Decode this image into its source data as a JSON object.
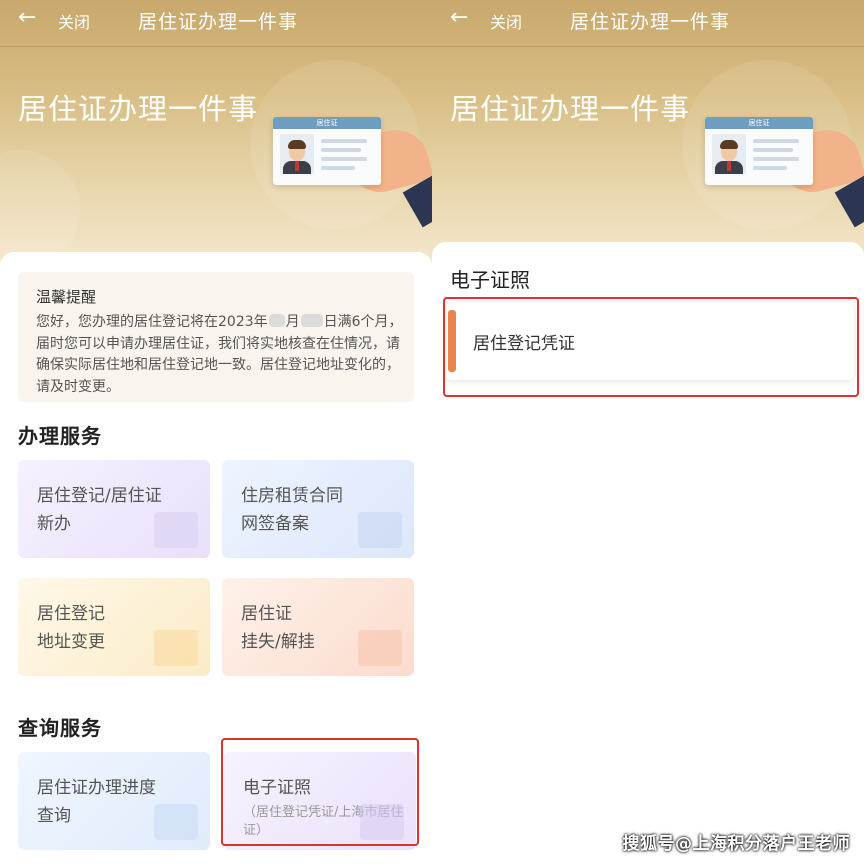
{
  "nav": {
    "back_glyph": "←",
    "close_label": "关闭",
    "title": "居住证办理一件事"
  },
  "hero": {
    "title": "居住证办理一件事",
    "card_header": "居住证"
  },
  "notice": {
    "title": "温馨提醒",
    "text_part1": "您好，您办理的居住登记将在2023年",
    "text_part2": "月",
    "text_part3": "日满6个月，届时您可以申请办理居住证，我们将实地核查在住情况，请确保实际居住地和居住登记地一致。居住登记地址变化的，请及时变更。"
  },
  "service_section": {
    "title": "办理服务",
    "tiles": [
      {
        "line1": "居住登记/居住证",
        "line2": "新办"
      },
      {
        "line1": "住房租赁合同",
        "line2": "网签备案"
      },
      {
        "line1": "居住登记",
        "line2": "地址变更"
      },
      {
        "line1": "居住证",
        "line2": "挂失/解挂"
      }
    ]
  },
  "query_section": {
    "title": "查询服务",
    "tiles": [
      {
        "line1": "居住证办理进度",
        "line2": "查询"
      },
      {
        "line1": "电子证照",
        "sub": "（居住登记凭证/上海市居住证）"
      }
    ]
  },
  "e_license": {
    "title": "电子证照",
    "item_label": "居住登记凭证"
  },
  "watermark": "搜狐号@上海积分落户王老师",
  "colors": {
    "hero_gold": "#c8a86c",
    "highlight_red": "#e0322d",
    "accent_orange": "#e9854f"
  }
}
